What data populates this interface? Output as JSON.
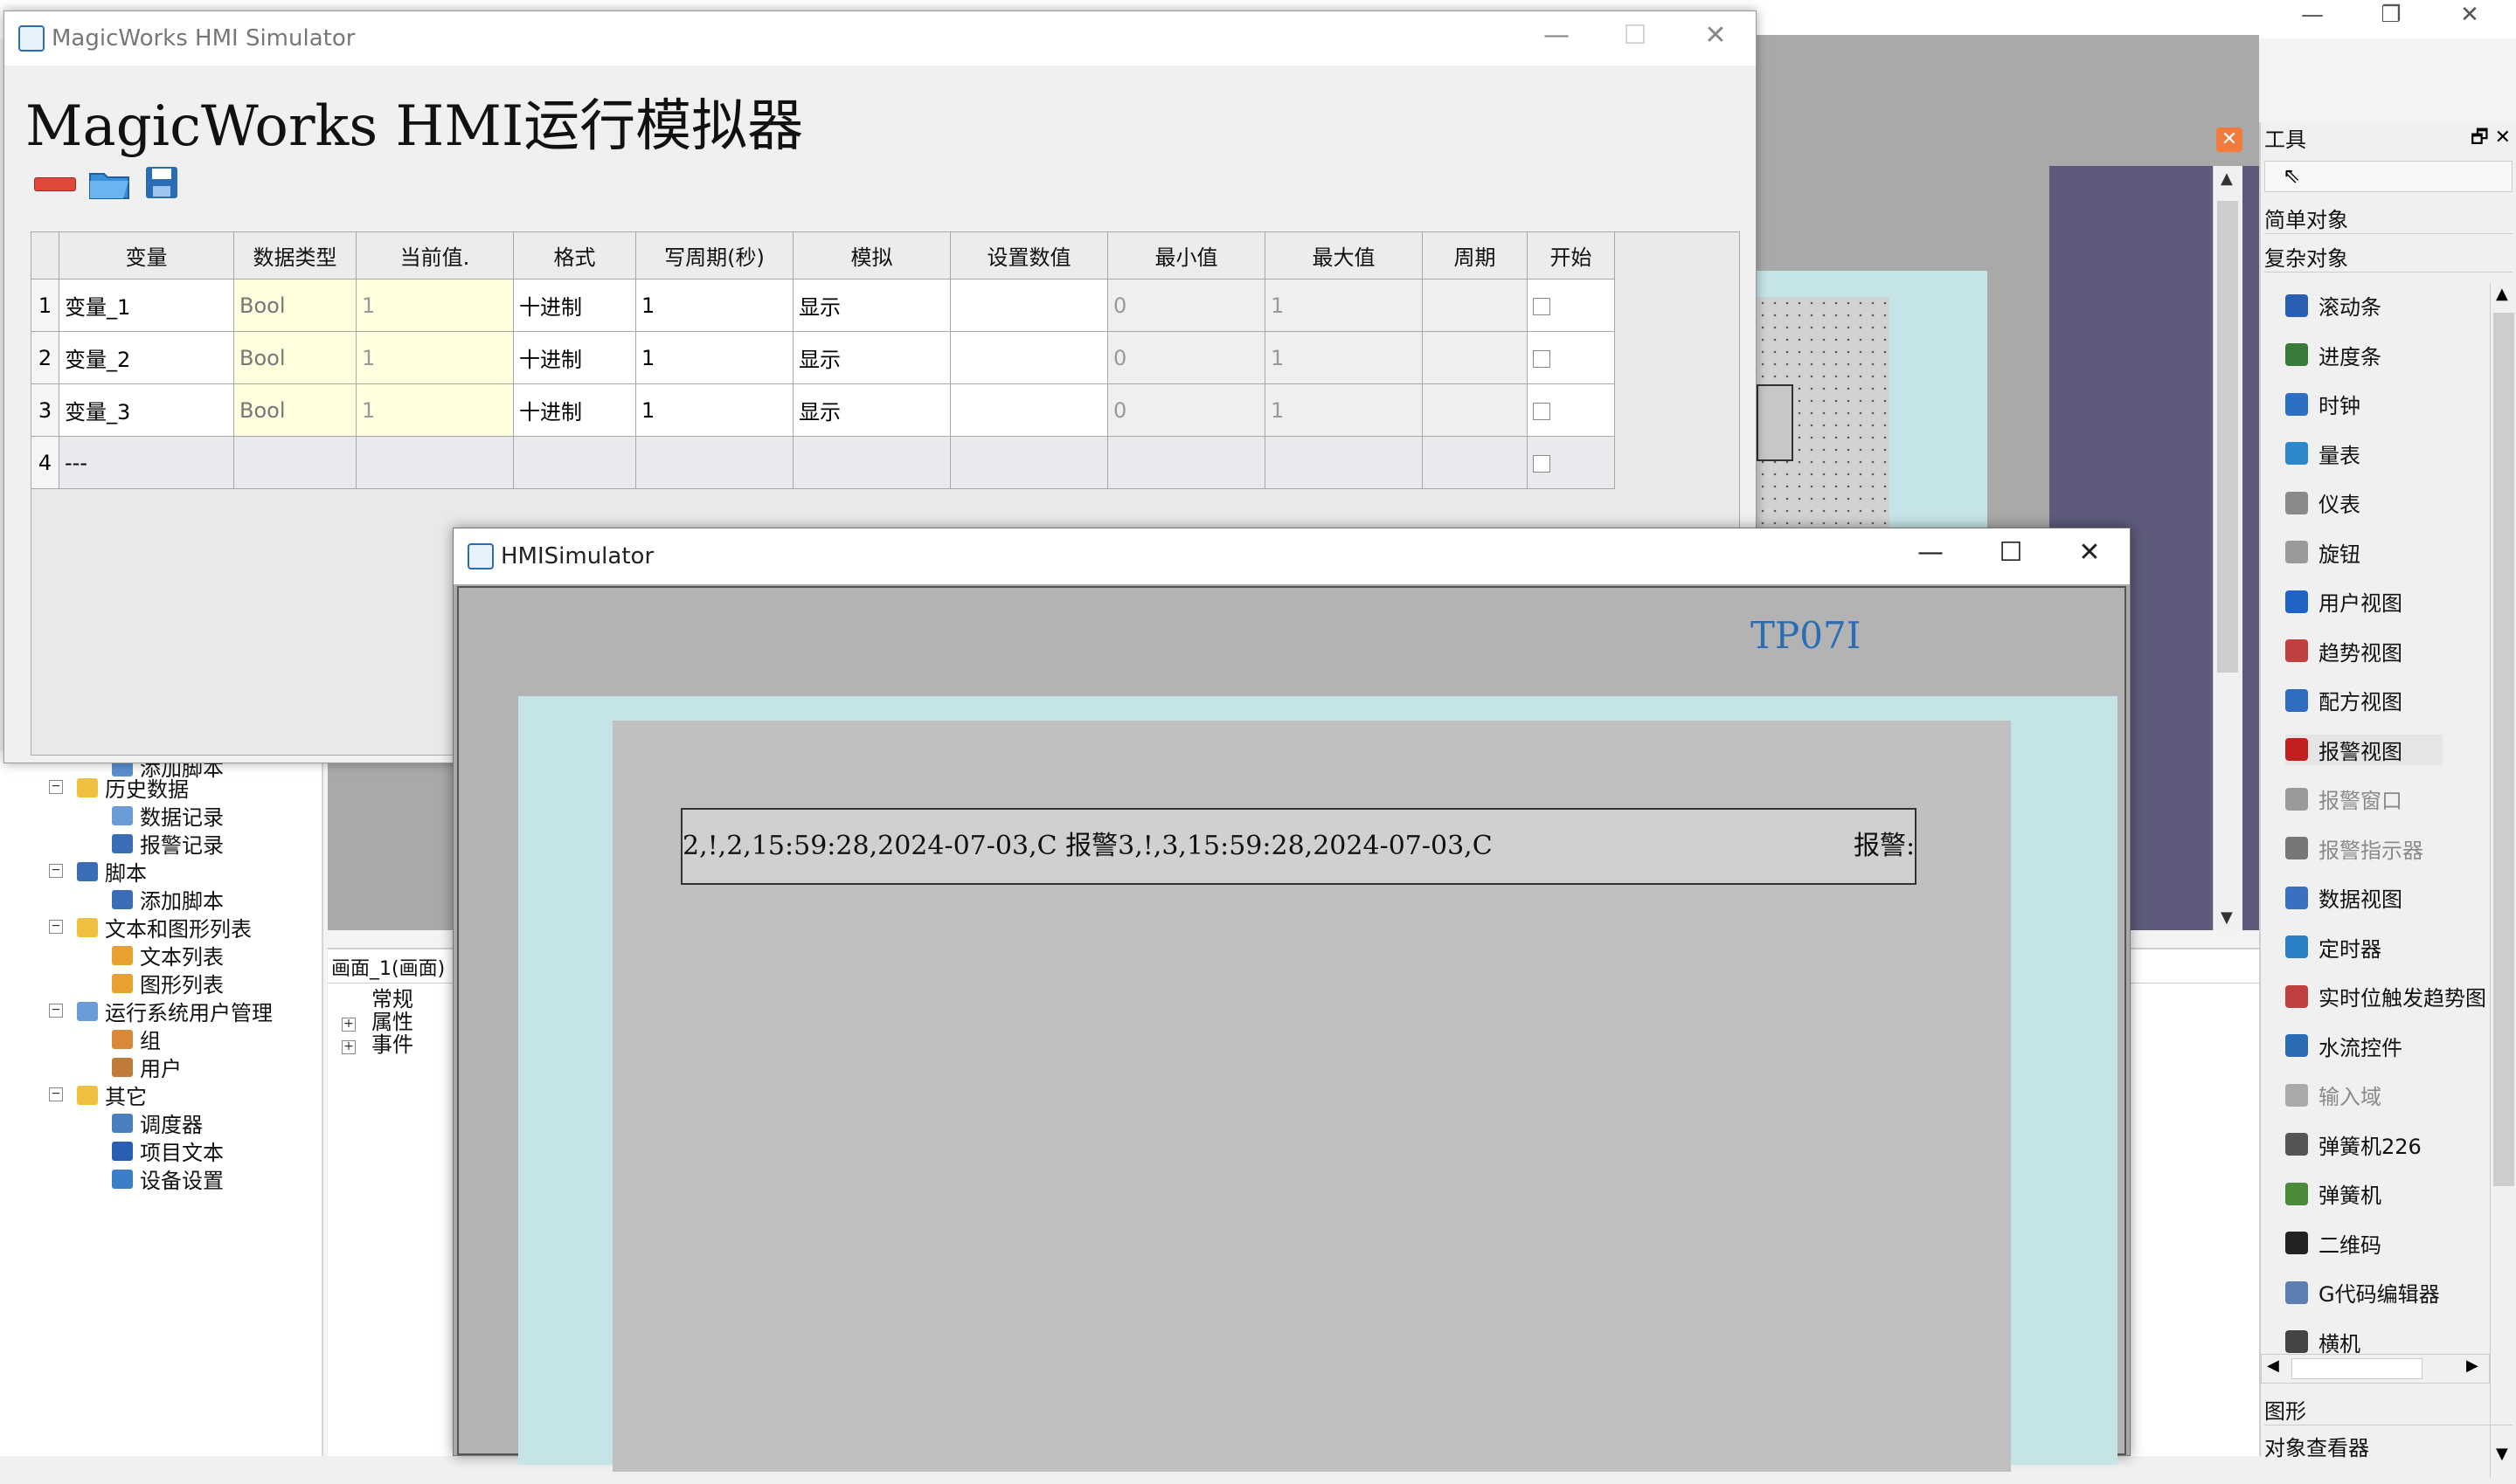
{
  "ide": {
    "tree": [
      {
        "label": "添加脚本",
        "level": 0
      },
      {
        "label": "历史数据",
        "level": 1
      },
      {
        "label": "数据记录",
        "level": 2
      },
      {
        "label": "报警记录",
        "level": 2
      },
      {
        "label": "脚本",
        "level": 1
      },
      {
        "label": "添加脚本",
        "level": 2
      },
      {
        "label": "文本和图形列表",
        "level": 1
      },
      {
        "label": "文本列表",
        "level": 2
      },
      {
        "label": "图形列表",
        "level": 2
      },
      {
        "label": "运行系统用户管理",
        "level": 1
      },
      {
        "label": "组",
        "level": 2
      },
      {
        "label": "用户",
        "level": 2
      },
      {
        "label": "其它",
        "level": 1
      },
      {
        "label": "调度器",
        "level": 2
      },
      {
        "label": "项目文本",
        "level": 2
      },
      {
        "label": "设备设置",
        "level": 2
      }
    ],
    "props_tab": "画面_1(画面)",
    "props_items": [
      "常规",
      "属性",
      "事件"
    ],
    "props_right_label": "常规",
    "toolbox": {
      "title": "工具",
      "simple_objects": "简单对象",
      "complex_objects": "复杂对象",
      "items": [
        {
          "label": "滚动条",
          "icon": "scrollbar-icon",
          "color": "#2b5fb3",
          "dim": false
        },
        {
          "label": "进度条",
          "icon": "progressbar-icon",
          "color": "#3a7a3a",
          "dim": false
        },
        {
          "label": "时钟",
          "icon": "clock-icon",
          "color": "#2d6fc4",
          "dim": false
        },
        {
          "label": "量表",
          "icon": "gauge-icon",
          "color": "#2c88c8",
          "dim": false
        },
        {
          "label": "仪表",
          "icon": "meter-icon",
          "color": "#8a8a8a",
          "dim": false
        },
        {
          "label": "旋钮",
          "icon": "knob-icon",
          "color": "#9a9a9a",
          "dim": false
        },
        {
          "label": "用户视图",
          "icon": "user-view-icon",
          "color": "#1f63c5",
          "dim": false
        },
        {
          "label": "趋势视图",
          "icon": "trend-view-icon",
          "color": "#c04040",
          "dim": false
        },
        {
          "label": "配方视图",
          "icon": "recipe-view-icon",
          "color": "#2f6dc0",
          "dim": false
        },
        {
          "label": "报警视图",
          "icon": "alarm-view-icon",
          "color": "#c02020",
          "dim": false
        },
        {
          "label": "报警窗口",
          "icon": "alarm-window-icon",
          "color": "#9a9a9a",
          "dim": true
        },
        {
          "label": "报警指示器",
          "icon": "alarm-indicator-icon",
          "color": "#777777",
          "dim": true
        },
        {
          "label": "数据视图",
          "icon": "data-view-icon",
          "color": "#3b6fc0",
          "dim": false
        },
        {
          "label": "定时器",
          "icon": "timer-icon",
          "color": "#2b7fc4",
          "dim": false
        },
        {
          "label": "实时位触发趋势图",
          "icon": "realtime-trend-icon",
          "color": "#c04040",
          "dim": false
        },
        {
          "label": "水流控件",
          "icon": "waterflow-icon",
          "color": "#2a6db5",
          "dim": false
        },
        {
          "label": "输入域",
          "icon": "input-field-icon",
          "color": "#aaaaaa",
          "dim": true
        },
        {
          "label": "弹簧机226",
          "icon": "spring-machine-226-icon",
          "color": "#555555",
          "dim": false
        },
        {
          "label": "弹簧机",
          "icon": "spring-machine-icon",
          "color": "#4a8a3a",
          "dim": false
        },
        {
          "label": "二维码",
          "icon": "qrcode-icon",
          "color": "#222222",
          "dim": false
        },
        {
          "label": "G代码编辑器",
          "icon": "gcode-editor-icon",
          "color": "#5b7fb0",
          "dim": false
        },
        {
          "label": "横机",
          "icon": "flat-knitting-icon",
          "color": "#444444",
          "dim": false
        }
      ],
      "graphics": "图形",
      "object_viewer": "对象查看器"
    }
  },
  "mw": {
    "window_title": "MagicWorks HMI Simulator",
    "heading": "MagicWorks HMI运行模拟器",
    "columns": [
      "变量",
      "数据类型",
      "当前值.",
      "格式",
      "写周期(秒)",
      "模拟",
      "设置数值",
      "最小值",
      "最大值",
      "周期",
      "开始"
    ],
    "rows": [
      {
        "n": "1",
        "var": "变量_1",
        "dtype": "Bool",
        "cur": "1",
        "fmt": "十进制",
        "wp": "1",
        "sim": "显示",
        "set": "",
        "min": "0",
        "max": "1",
        "per": ""
      },
      {
        "n": "2",
        "var": "变量_2",
        "dtype": "Bool",
        "cur": "1",
        "fmt": "十进制",
        "wp": "1",
        "sim": "显示",
        "set": "",
        "min": "0",
        "max": "1",
        "per": ""
      },
      {
        "n": "3",
        "var": "变量_3",
        "dtype": "Bool",
        "cur": "1",
        "fmt": "十进制",
        "wp": "1",
        "sim": "显示",
        "set": "",
        "min": "0",
        "max": "1",
        "per": ""
      },
      {
        "n": "4",
        "var": "---",
        "dtype": "",
        "cur": "",
        "fmt": "",
        "wp": "",
        "sim": "",
        "set": "",
        "min": "",
        "max": "",
        "per": ""
      }
    ]
  },
  "hmi": {
    "window_title": "HMISimulator",
    "device": "TP07I",
    "alarm_text": "2,!,2,15:59:28,2024-07-03,C 报警3,!,3,15:59:28,2024-07-03,C",
    "alarm_tail": "报警:"
  },
  "colors": {
    "accent_blue": "#2a6db5",
    "hmi_cyan": "#c5e4e8",
    "ide_dark": "#5d5a7b",
    "cell_yellow": "#ffffe0"
  }
}
